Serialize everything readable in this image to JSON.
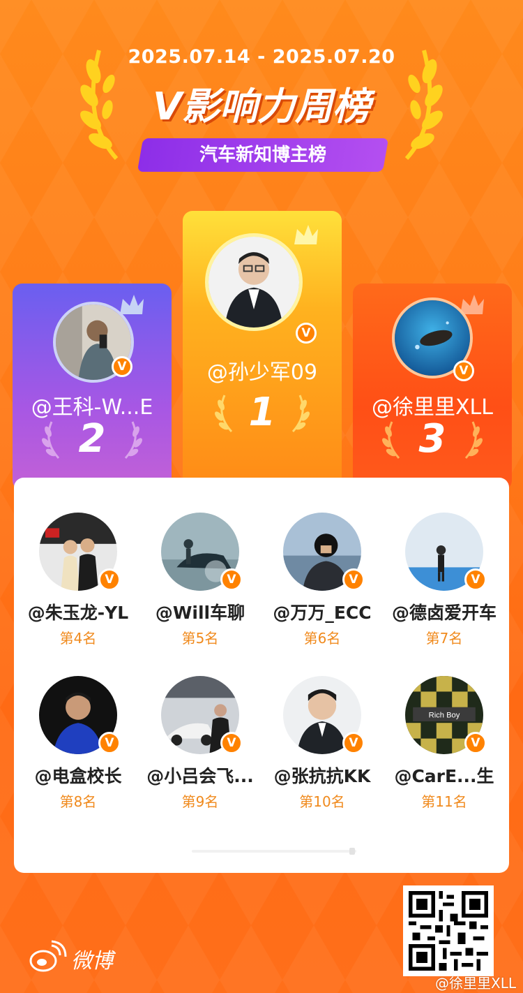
{
  "header": {
    "date_range": "2025.07.14 - 2025.07.20",
    "title_prefix": "V",
    "title_rest": "影响力周榜",
    "subtitle": "汽车新知博主榜"
  },
  "podium": [
    {
      "name": "@孙少军09",
      "rank": "1"
    },
    {
      "name": "@王科-W...E",
      "rank": "2"
    },
    {
      "name": "@徐里里XLL",
      "rank": "3"
    }
  ],
  "ranking": [
    {
      "name": "@朱玉龙-YL",
      "rank": "第4名"
    },
    {
      "name": "@Will车聊",
      "rank": "第5名"
    },
    {
      "name": "@万万_ECC",
      "rank": "第6名"
    },
    {
      "name": "@德卤爱开车",
      "rank": "第7名"
    },
    {
      "name": "@电盒校长",
      "rank": "第8名"
    },
    {
      "name": "@小吕会飞...",
      "rank": "第9名"
    },
    {
      "name": "@张抗抗KK",
      "rank": "第10名"
    },
    {
      "name": "@CarE...生",
      "rank": "第11名"
    }
  ],
  "avatar_labels": {
    "rank11_sign": "Rich Boy"
  },
  "badge_glyph": "V",
  "footer": {
    "logo_text": "微博",
    "watermark": "@徐里里XLL"
  },
  "colors": {
    "accent_orange": "#ff7a18",
    "badge_orange": "#ff8200",
    "rank_text": "#f08a1d",
    "banner_purple": "#8d2ee8"
  }
}
